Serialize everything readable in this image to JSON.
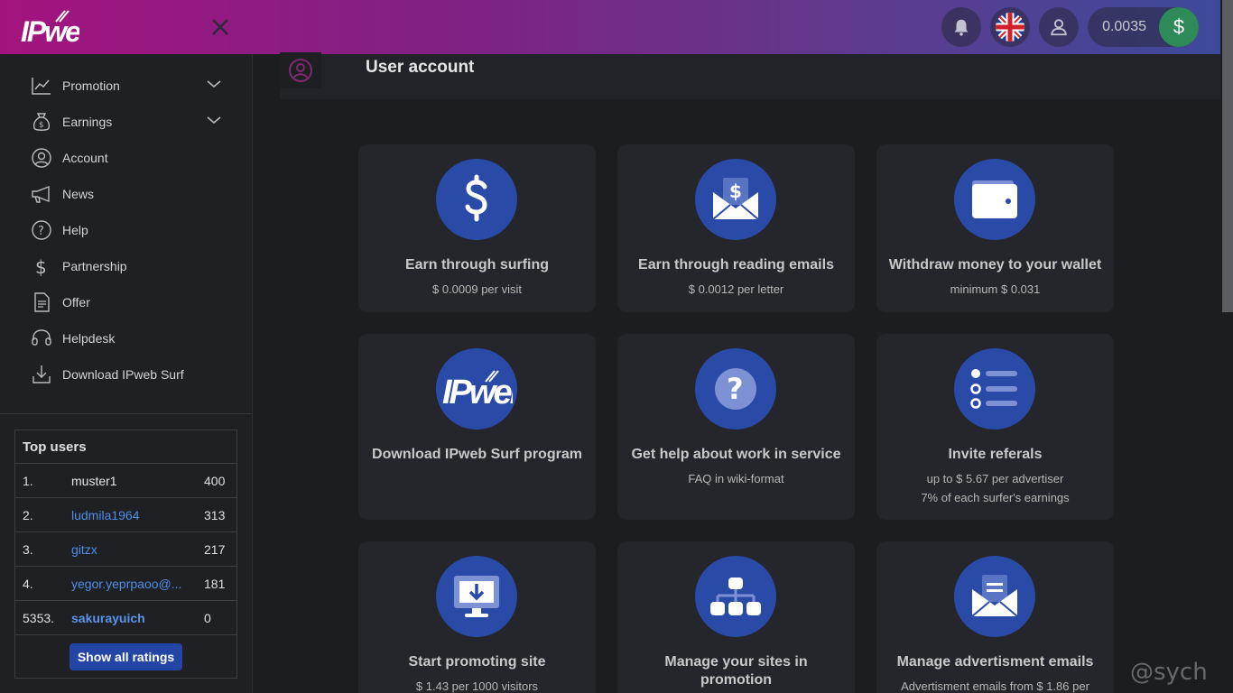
{
  "header": {
    "logo_text": "IPweb",
    "balance": "0.0035",
    "currency_symbol": "$"
  },
  "sidebar": {
    "items": [
      {
        "label": "Promotion",
        "icon": "chart-line-icon",
        "expandable": true
      },
      {
        "label": "Earnings",
        "icon": "money-bag-icon",
        "expandable": true
      },
      {
        "label": "Account",
        "icon": "user-circle-icon",
        "expandable": false
      },
      {
        "label": "News",
        "icon": "megaphone-icon",
        "expandable": false
      },
      {
        "label": "Help",
        "icon": "question-circle-icon",
        "expandable": false
      },
      {
        "label": "Partnership",
        "icon": "dollar-icon",
        "expandable": false
      },
      {
        "label": "Offer",
        "icon": "document-icon",
        "expandable": false
      },
      {
        "label": "Helpdesk",
        "icon": "headset-icon",
        "expandable": false
      },
      {
        "label": "Download IPweb Surf",
        "icon": "download-icon",
        "expandable": false
      }
    ]
  },
  "top_users": {
    "title": "Top users",
    "rows": [
      {
        "rank": "1.",
        "name": "muster1",
        "score": "400"
      },
      {
        "rank": "2.",
        "name": "ludmila1964",
        "score": "313"
      },
      {
        "rank": "3.",
        "name": "gitzx",
        "score": "217"
      },
      {
        "rank": "4.",
        "name": "yegor.yeprpaoo@...",
        "score": "181"
      },
      {
        "rank": "5353.",
        "name": "sakurayuich",
        "score": "0"
      }
    ],
    "show_all_label": "Show all ratings"
  },
  "main": {
    "title": "User account",
    "cards": [
      {
        "title": "Earn through surfing",
        "sub": [
          "$ 0.0009 per visit"
        ],
        "icon": "dollar-sign-icon"
      },
      {
        "title": "Earn through reading emails",
        "sub": [
          "$ 0.0012 per letter"
        ],
        "icon": "envelope-money-icon"
      },
      {
        "title": "Withdraw money to your wallet",
        "sub": [
          "minimum $ 0.031"
        ],
        "icon": "wallet-icon"
      },
      {
        "title": "Download IPweb Surf program",
        "sub": [],
        "icon": "ipweb-logo-icon"
      },
      {
        "title": "Get help about work in service",
        "sub": [
          "FAQ in wiki-format"
        ],
        "icon": "question-icon"
      },
      {
        "title": "Invite referals",
        "sub": [
          "up to $ 5.67 per advertiser",
          "7% of each surfer's earnings"
        ],
        "icon": "list-icon"
      },
      {
        "title": "Start promoting site",
        "sub": [
          "$ 1.43 per 1000 visitors"
        ],
        "icon": "monitor-download-icon"
      },
      {
        "title": "Manage your sites in promotion",
        "sub": [],
        "icon": "sitemap-icon"
      },
      {
        "title": "Manage advertisment emails",
        "sub": [
          "Advertisment emails from $ 1.86 per"
        ],
        "icon": "envelope-letter-icon"
      }
    ]
  },
  "watermark": "@sych",
  "colors": {
    "accent_blue": "#2a4aa8",
    "top_gradient_start": "#a3137e",
    "top_gradient_end": "#3d4a9a",
    "balance_green": "#2e8a58"
  }
}
